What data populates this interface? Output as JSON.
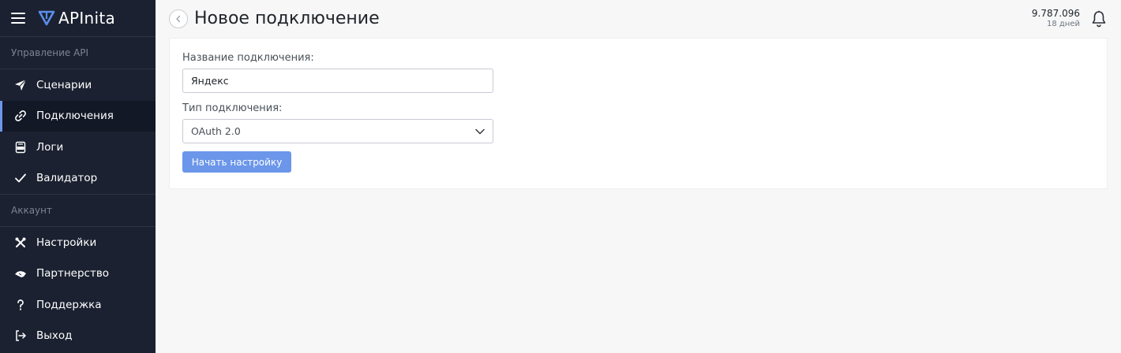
{
  "app": {
    "name": "APInita"
  },
  "sidebar": {
    "sections": [
      {
        "title": "Управление API",
        "items": [
          {
            "label": "Сценарии",
            "icon": "send-icon",
            "active": false
          },
          {
            "label": "Подключения",
            "icon": "link-icon",
            "active": true
          },
          {
            "label": "Логи",
            "icon": "log-file-icon",
            "active": false
          },
          {
            "label": "Валидатор",
            "icon": "check-icon",
            "active": false
          }
        ]
      },
      {
        "title": "Аккаунт",
        "items": [
          {
            "label": "Настройки",
            "icon": "tools-icon",
            "active": false
          },
          {
            "label": "Партнерство",
            "icon": "handshake-icon",
            "active": false
          },
          {
            "label": "Поддержка",
            "icon": "question-icon",
            "active": false
          },
          {
            "label": "Выход",
            "icon": "logout-icon",
            "active": false
          }
        ]
      }
    ]
  },
  "header": {
    "title": "Новое подключение",
    "balance": "9.787.096",
    "days": "18 дней"
  },
  "form": {
    "name_label": "Название подключения:",
    "name_value": "Яндекс",
    "type_label": "Тип подключения:",
    "type_value": "OAuth 2.0",
    "submit_label": "Начать настройку"
  },
  "colors": {
    "sidebar_bg": "#1b2130",
    "accent": "#6b96ea",
    "page_bg": "#f7f7f8"
  }
}
